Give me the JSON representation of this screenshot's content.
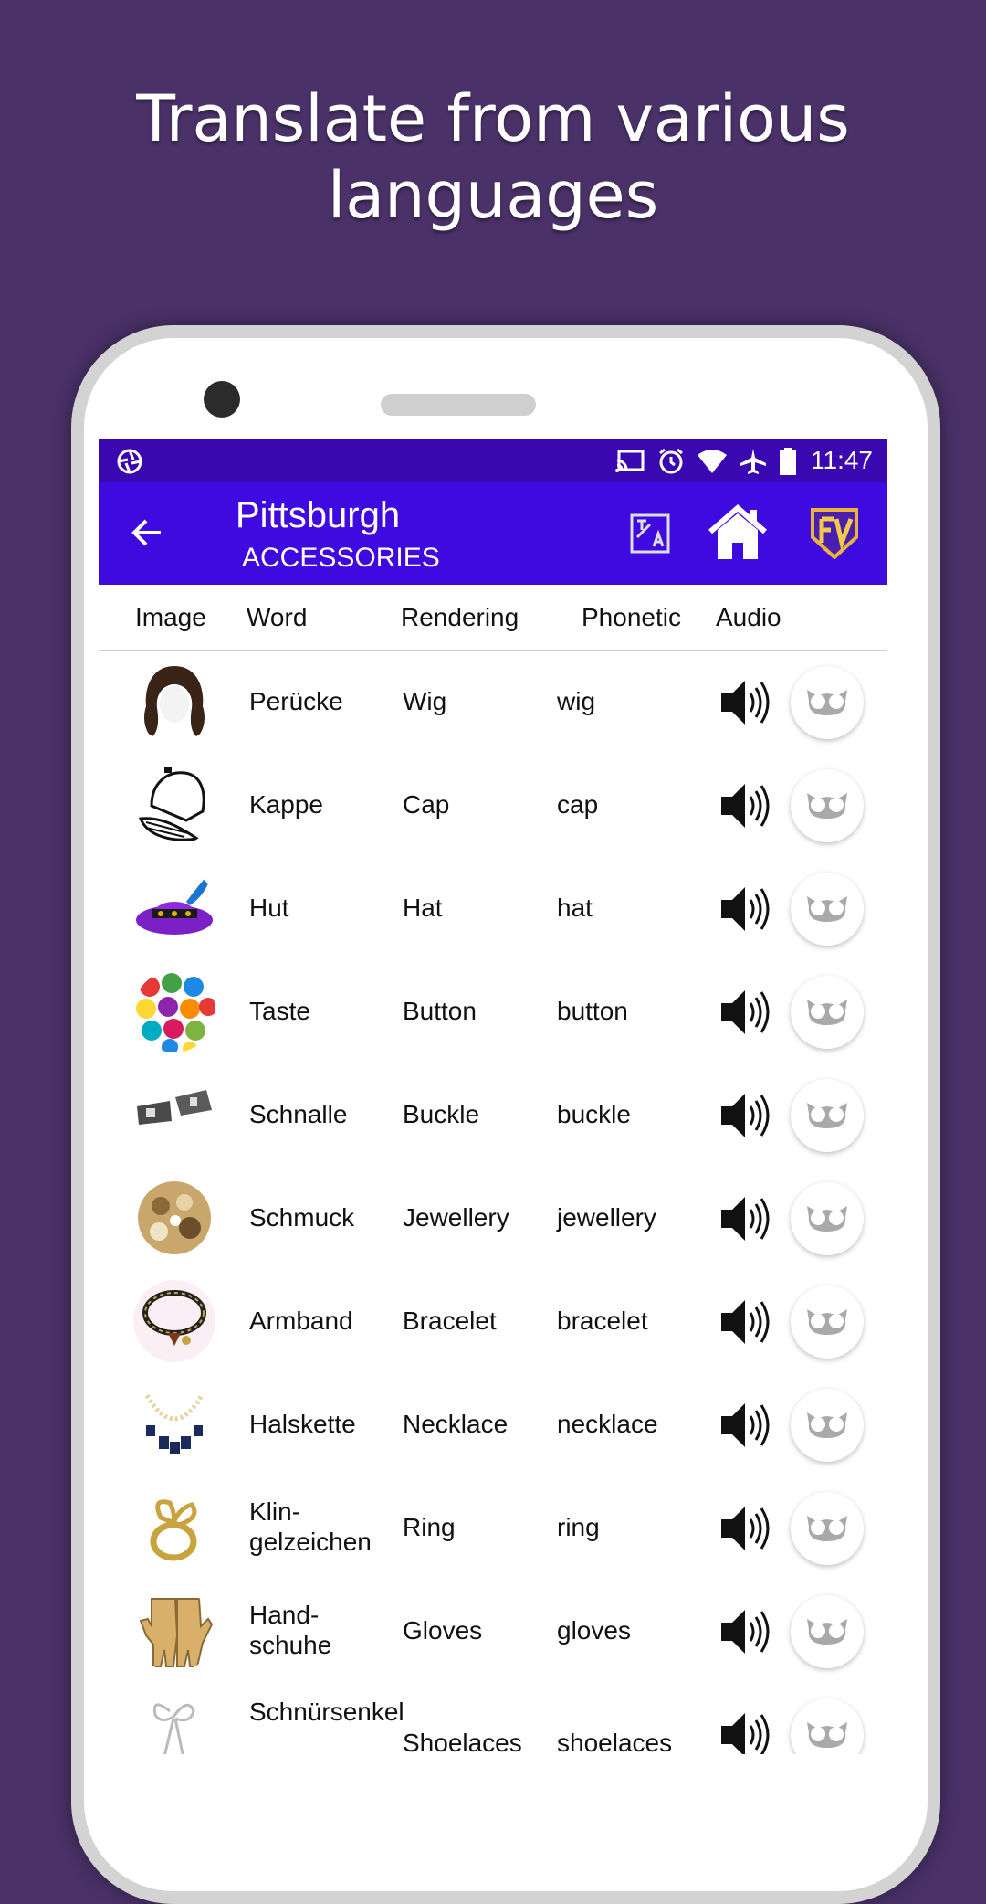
{
  "promo": {
    "line1": "Translate from various",
    "line2": "languages"
  },
  "status_bar": {
    "time": "11:47"
  },
  "app_bar": {
    "title": "Pittsburgh",
    "subtitle": "ACCESSORIES"
  },
  "columns": {
    "image": "Image",
    "word": "Word",
    "rendering": "Rendering",
    "phonetic": "Phonetic",
    "audio": "Audio"
  },
  "colors": {
    "status_bar": "#3a08b0",
    "app_bar": "#3f0ae0",
    "background": "#4a3168"
  },
  "rows": [
    {
      "word": "Perücke",
      "rendering": "Wig",
      "phonetic": "wig",
      "image": "wig-icon"
    },
    {
      "word": "Kappe",
      "rendering": "Cap",
      "phonetic": "cap",
      "image": "cap-icon"
    },
    {
      "word": "Hut",
      "rendering": "Hat",
      "phonetic": "hat",
      "image": "hat-icon"
    },
    {
      "word": "Taste",
      "rendering": "Button",
      "phonetic": "button",
      "image": "buttons-icon"
    },
    {
      "word": "Schnalle",
      "rendering": "Buckle",
      "phonetic": "buckle",
      "image": "buckle-icon"
    },
    {
      "word": "Schmuck",
      "rendering": "Jewellery",
      "phonetic": "jewellery",
      "image": "jewellery-icon"
    },
    {
      "word": "Armband",
      "rendering": "Bracelet",
      "phonetic": "bracelet",
      "image": "bracelet-icon"
    },
    {
      "word": "Halskette",
      "rendering": "Necklace",
      "phonetic": "necklace",
      "image": "necklace-icon"
    },
    {
      "word": "Klin-gelzeichen",
      "rendering": "Ring",
      "phonetic": "ring",
      "image": "ring-icon"
    },
    {
      "word": "Hand-schuhe",
      "rendering": "Gloves",
      "phonetic": "gloves",
      "image": "gloves-icon"
    },
    {
      "word": "Schnürsenkel",
      "rendering": "Shoelaces",
      "phonetic": "shoelaces",
      "image": "shoelaces-icon"
    }
  ]
}
